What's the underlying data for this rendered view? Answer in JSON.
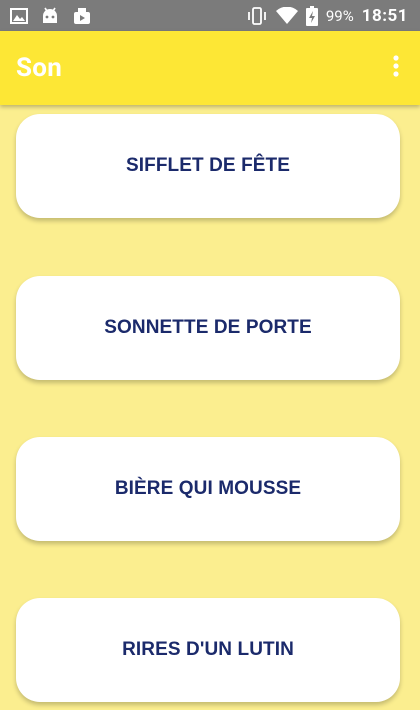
{
  "status_bar": {
    "battery": "99%",
    "time": "18:51",
    "icons": [
      "image-icon",
      "android-icon",
      "media-icon",
      "vibrate-icon",
      "wifi-icon",
      "battery-icon"
    ]
  },
  "app_bar": {
    "title": "Son",
    "background": "#fde735",
    "menu_icon": "overflow-menu-icon"
  },
  "sounds": [
    {
      "label": "SIFFLET DE FÊTE"
    },
    {
      "label": "SONNETTE DE PORTE"
    },
    {
      "label": "BIÈRE QUI MOUSSE"
    },
    {
      "label": "RIRES D'UN LUTIN"
    }
  ],
  "colors": {
    "page_background": "#fbee8f",
    "card_text": "#1b2a6b"
  }
}
